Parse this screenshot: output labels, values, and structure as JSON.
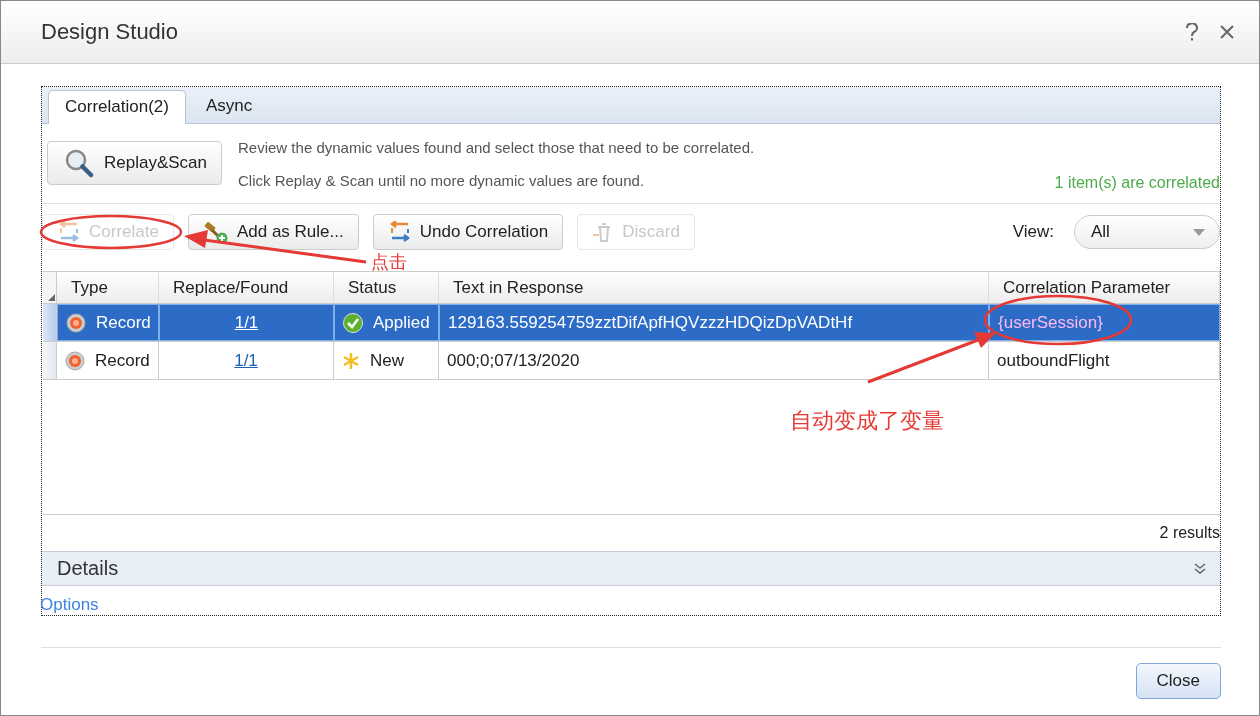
{
  "window": {
    "title": "Design Studio"
  },
  "tabs": [
    {
      "label": "Correlation(2)",
      "selected": true
    },
    {
      "label": "Async",
      "selected": false
    }
  ],
  "scan_button": {
    "label": "Replay&Scan"
  },
  "instructions": [
    "Review the dynamic values found and select those that need to be correlated.",
    "Click Replay & Scan until no more dynamic values are found."
  ],
  "correlated_status": "1 item(s) are correlated",
  "toolbar": [
    {
      "kind": "correlate",
      "label": "Correlate",
      "disabled": true
    },
    {
      "kind": "rule",
      "label": "Add as Rule...",
      "disabled": false
    },
    {
      "kind": "undo",
      "label": "Undo Correlation",
      "disabled": false
    },
    {
      "kind": "discard",
      "label": "Discard",
      "disabled": true
    }
  ],
  "view": {
    "label": "View:",
    "value": "All"
  },
  "table": {
    "columns": [
      "Type",
      "Replace/Found",
      "Status",
      "Text in Response",
      "Correlation Parameter"
    ],
    "rows": [
      {
        "selected": true,
        "type": "Record",
        "replace_found": "1/1",
        "status": {
          "kind": "applied",
          "text": "Applied"
        },
        "text_in_response": "129163.559254759zztDifApfHQVzzzHDQizDpVADtHf",
        "parameter": "{userSession}",
        "correlated": true
      },
      {
        "selected": false,
        "type": "Record",
        "replace_found": "1/1",
        "status": {
          "kind": "new",
          "text": "New"
        },
        "text_in_response": "000;0;07/13/2020",
        "parameter": "outboundFlight",
        "correlated": false
      }
    ]
  },
  "results": "2 results",
  "details": {
    "label": "Details",
    "expanded": false
  },
  "options_link": "Options",
  "close_button": "Close",
  "annotations": [
    "点击",
    "自动变成了变量"
  ]
}
